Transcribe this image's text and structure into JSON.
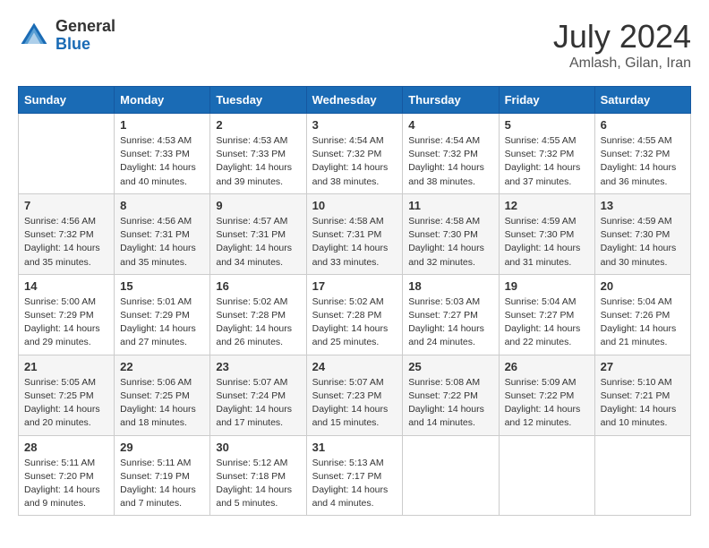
{
  "header": {
    "logo_general": "General",
    "logo_blue": "Blue",
    "month_year": "July 2024",
    "location": "Amlash, Gilan, Iran"
  },
  "days_of_week": [
    "Sunday",
    "Monday",
    "Tuesday",
    "Wednesday",
    "Thursday",
    "Friday",
    "Saturday"
  ],
  "weeks": [
    [
      {
        "day": "",
        "info": ""
      },
      {
        "day": "1",
        "info": "Sunrise: 4:53 AM\nSunset: 7:33 PM\nDaylight: 14 hours\nand 40 minutes."
      },
      {
        "day": "2",
        "info": "Sunrise: 4:53 AM\nSunset: 7:33 PM\nDaylight: 14 hours\nand 39 minutes."
      },
      {
        "day": "3",
        "info": "Sunrise: 4:54 AM\nSunset: 7:32 PM\nDaylight: 14 hours\nand 38 minutes."
      },
      {
        "day": "4",
        "info": "Sunrise: 4:54 AM\nSunset: 7:32 PM\nDaylight: 14 hours\nand 38 minutes."
      },
      {
        "day": "5",
        "info": "Sunrise: 4:55 AM\nSunset: 7:32 PM\nDaylight: 14 hours\nand 37 minutes."
      },
      {
        "day": "6",
        "info": "Sunrise: 4:55 AM\nSunset: 7:32 PM\nDaylight: 14 hours\nand 36 minutes."
      }
    ],
    [
      {
        "day": "7",
        "info": "Sunrise: 4:56 AM\nSunset: 7:32 PM\nDaylight: 14 hours\nand 35 minutes."
      },
      {
        "day": "8",
        "info": "Sunrise: 4:56 AM\nSunset: 7:31 PM\nDaylight: 14 hours\nand 35 minutes."
      },
      {
        "day": "9",
        "info": "Sunrise: 4:57 AM\nSunset: 7:31 PM\nDaylight: 14 hours\nand 34 minutes."
      },
      {
        "day": "10",
        "info": "Sunrise: 4:58 AM\nSunset: 7:31 PM\nDaylight: 14 hours\nand 33 minutes."
      },
      {
        "day": "11",
        "info": "Sunrise: 4:58 AM\nSunset: 7:30 PM\nDaylight: 14 hours\nand 32 minutes."
      },
      {
        "day": "12",
        "info": "Sunrise: 4:59 AM\nSunset: 7:30 PM\nDaylight: 14 hours\nand 31 minutes."
      },
      {
        "day": "13",
        "info": "Sunrise: 4:59 AM\nSunset: 7:30 PM\nDaylight: 14 hours\nand 30 minutes."
      }
    ],
    [
      {
        "day": "14",
        "info": "Sunrise: 5:00 AM\nSunset: 7:29 PM\nDaylight: 14 hours\nand 29 minutes."
      },
      {
        "day": "15",
        "info": "Sunrise: 5:01 AM\nSunset: 7:29 PM\nDaylight: 14 hours\nand 27 minutes."
      },
      {
        "day": "16",
        "info": "Sunrise: 5:02 AM\nSunset: 7:28 PM\nDaylight: 14 hours\nand 26 minutes."
      },
      {
        "day": "17",
        "info": "Sunrise: 5:02 AM\nSunset: 7:28 PM\nDaylight: 14 hours\nand 25 minutes."
      },
      {
        "day": "18",
        "info": "Sunrise: 5:03 AM\nSunset: 7:27 PM\nDaylight: 14 hours\nand 24 minutes."
      },
      {
        "day": "19",
        "info": "Sunrise: 5:04 AM\nSunset: 7:27 PM\nDaylight: 14 hours\nand 22 minutes."
      },
      {
        "day": "20",
        "info": "Sunrise: 5:04 AM\nSunset: 7:26 PM\nDaylight: 14 hours\nand 21 minutes."
      }
    ],
    [
      {
        "day": "21",
        "info": "Sunrise: 5:05 AM\nSunset: 7:25 PM\nDaylight: 14 hours\nand 20 minutes."
      },
      {
        "day": "22",
        "info": "Sunrise: 5:06 AM\nSunset: 7:25 PM\nDaylight: 14 hours\nand 18 minutes."
      },
      {
        "day": "23",
        "info": "Sunrise: 5:07 AM\nSunset: 7:24 PM\nDaylight: 14 hours\nand 17 minutes."
      },
      {
        "day": "24",
        "info": "Sunrise: 5:07 AM\nSunset: 7:23 PM\nDaylight: 14 hours\nand 15 minutes."
      },
      {
        "day": "25",
        "info": "Sunrise: 5:08 AM\nSunset: 7:22 PM\nDaylight: 14 hours\nand 14 minutes."
      },
      {
        "day": "26",
        "info": "Sunrise: 5:09 AM\nSunset: 7:22 PM\nDaylight: 14 hours\nand 12 minutes."
      },
      {
        "day": "27",
        "info": "Sunrise: 5:10 AM\nSunset: 7:21 PM\nDaylight: 14 hours\nand 10 minutes."
      }
    ],
    [
      {
        "day": "28",
        "info": "Sunrise: 5:11 AM\nSunset: 7:20 PM\nDaylight: 14 hours\nand 9 minutes."
      },
      {
        "day": "29",
        "info": "Sunrise: 5:11 AM\nSunset: 7:19 PM\nDaylight: 14 hours\nand 7 minutes."
      },
      {
        "day": "30",
        "info": "Sunrise: 5:12 AM\nSunset: 7:18 PM\nDaylight: 14 hours\nand 5 minutes."
      },
      {
        "day": "31",
        "info": "Sunrise: 5:13 AM\nSunset: 7:17 PM\nDaylight: 14 hours\nand 4 minutes."
      },
      {
        "day": "",
        "info": ""
      },
      {
        "day": "",
        "info": ""
      },
      {
        "day": "",
        "info": ""
      }
    ]
  ]
}
